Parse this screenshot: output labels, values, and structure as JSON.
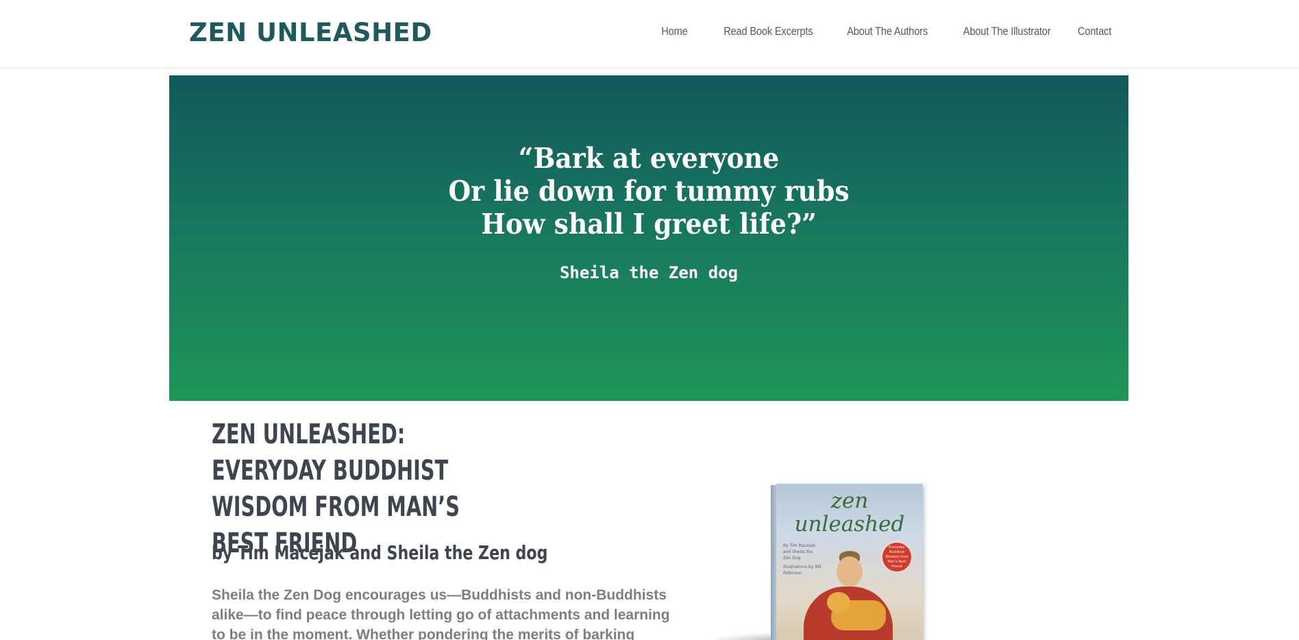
{
  "header": {
    "logo": "ZEN UNLEASHED",
    "nav": [
      {
        "label": "Home"
      },
      {
        "label": "Read Book Excerpts"
      },
      {
        "label": "About The Authors"
      },
      {
        "label": "About The Illustrator"
      },
      {
        "label": "Contact"
      }
    ]
  },
  "hero": {
    "quote_lines": [
      "“Bark at everyone",
      "Or lie down for tummy rubs",
      "How shall I greet life?”"
    ],
    "attribution": "Sheila the Zen dog",
    "colors": {
      "top": "#12585b",
      "bottom": "#1f9656"
    }
  },
  "product": {
    "title": "ZEN UNLEASHED: EVERYDAY BUDDHIST WISDOM FROM MAN’S BEST FRIEND",
    "byline": "by Tim Macejak and Sheila the Zen dog",
    "description": "Sheila the Zen Dog encourages us—Buddhists and non-Buddhists alike—to find peace through letting go of attachments and learning to be in the moment. Whether pondering the merits of barking",
    "book_cover": {
      "title_line1": "zen",
      "title_line2": "unleashed",
      "authors": "By Tim Macejak and Sheila the Zen Dog",
      "illustrator": "Illustrations by Bill Robinson",
      "seal": "Everyday Buddhist Wisdom from Man's Best Friend"
    }
  }
}
